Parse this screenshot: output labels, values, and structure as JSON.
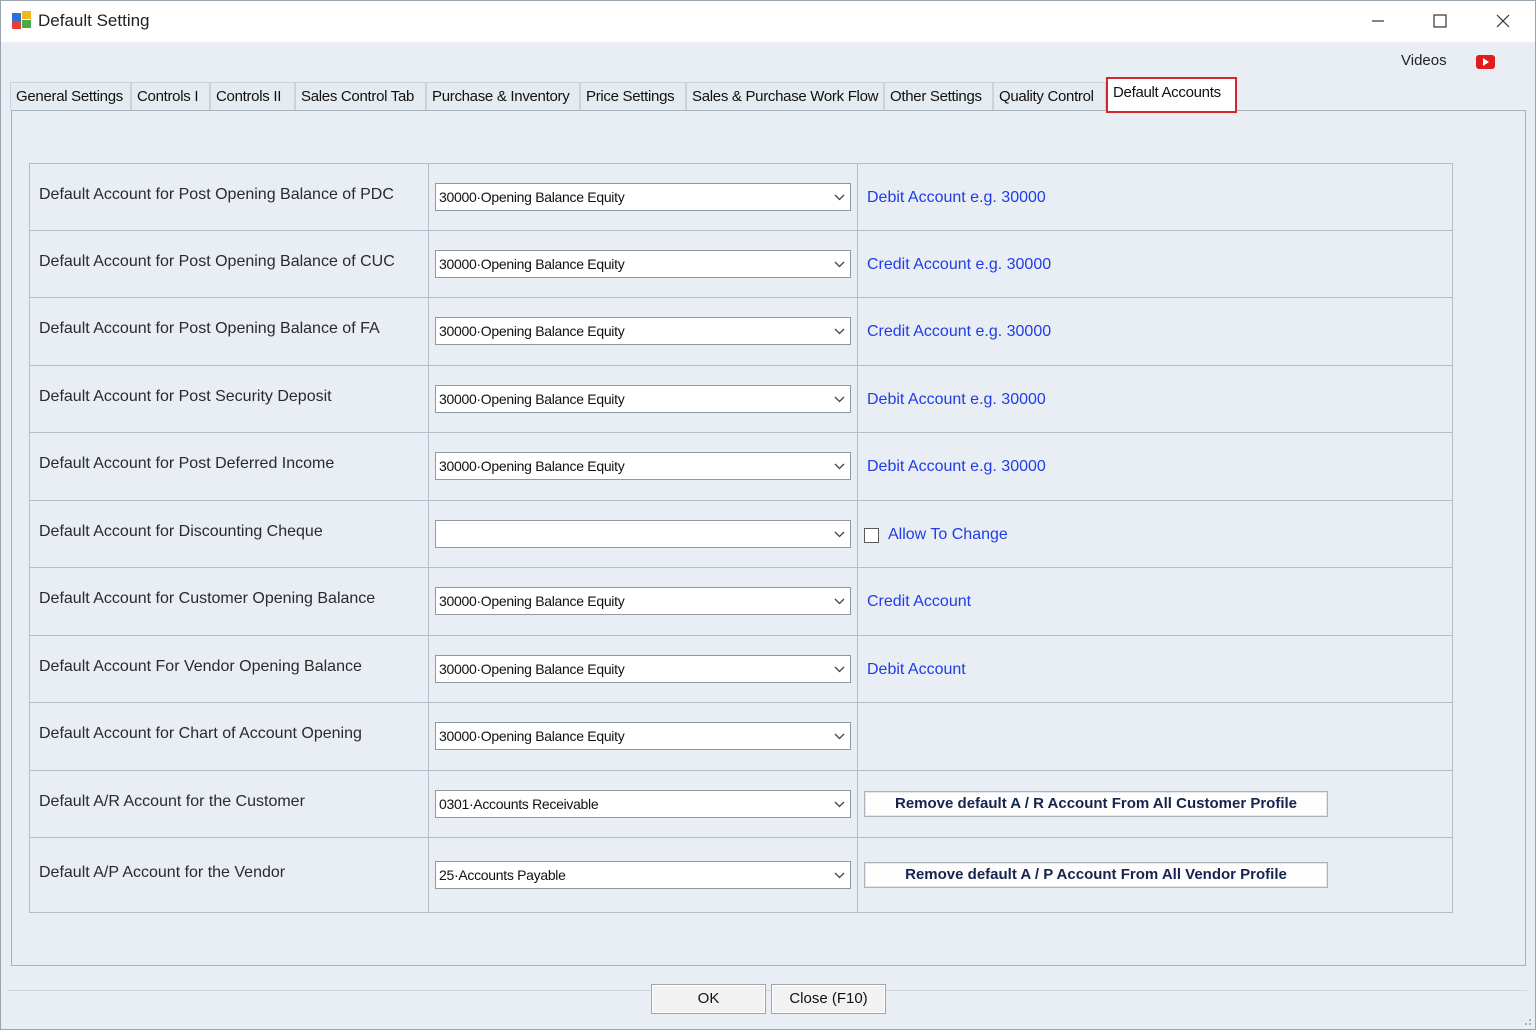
{
  "window": {
    "title": "Default Setting",
    "videos_label": "Videos"
  },
  "tabs": [
    {
      "label": "General Settings"
    },
    {
      "label": "Controls I"
    },
    {
      "label": "Controls II"
    },
    {
      "label": "Sales Control Tab"
    },
    {
      "label": "Purchase & Inventory"
    },
    {
      "label": "Price Settings"
    },
    {
      "label": "Sales & Purchase Work Flow"
    },
    {
      "label": "Other Settings"
    },
    {
      "label": "Quality Control"
    },
    {
      "label": "Default Accounts"
    }
  ],
  "active_tab": "Default Accounts",
  "rows": [
    {
      "label": "Default Account for Post Opening Balance of PDC",
      "value": "30000·Opening Balance Equity",
      "hint": "Debit Account e.g. 30000"
    },
    {
      "label": "Default Account for Post Opening Balance of CUC",
      "value": "30000·Opening Balance Equity",
      "hint": "Credit Account e.g. 30000"
    },
    {
      "label": "Default Account for Post Opening Balance of FA",
      "value": "30000·Opening Balance Equity",
      "hint": "Credit Account e.g. 30000"
    },
    {
      "label": "Default Account for Post Security Deposit",
      "value": "30000·Opening Balance Equity",
      "hint": "Debit Account e.g. 30000"
    },
    {
      "label": "Default Account for Post Deferred Income",
      "value": "30000·Opening Balance Equity",
      "hint": "Debit Account e.g. 30000"
    },
    {
      "label": "Default Account for Discounting Cheque",
      "value": "",
      "checkbox_label": "Allow To Change",
      "checkbox_checked": false
    },
    {
      "label": "Default Account for Customer Opening Balance",
      "value": "30000·Opening Balance Equity",
      "hint": "Credit Account"
    },
    {
      "label": "Default Account For Vendor Opening Balance",
      "value": "30000·Opening Balance Equity",
      "hint": "Debit Account"
    },
    {
      "label": "Default Account for Chart of Account Opening",
      "value": "30000·Opening Balance Equity"
    },
    {
      "label": "Default A/R Account for the Customer",
      "value": "0301·Accounts Receivable",
      "button": "Remove default A / R Account From All Customer Profile"
    },
    {
      "label": "Default A/P Account for the Vendor",
      "value": "25·Accounts Payable",
      "button": "Remove default A / P Account From All Vendor Profile"
    }
  ],
  "footer": {
    "ok_label": "OK",
    "close_label": "Close (F10)"
  },
  "colors": {
    "hint_text": "#1f3ce6",
    "active_tab_outline": "#d1282e",
    "panel_background": "#e9eef4",
    "video_icon": "#e21b1b"
  }
}
